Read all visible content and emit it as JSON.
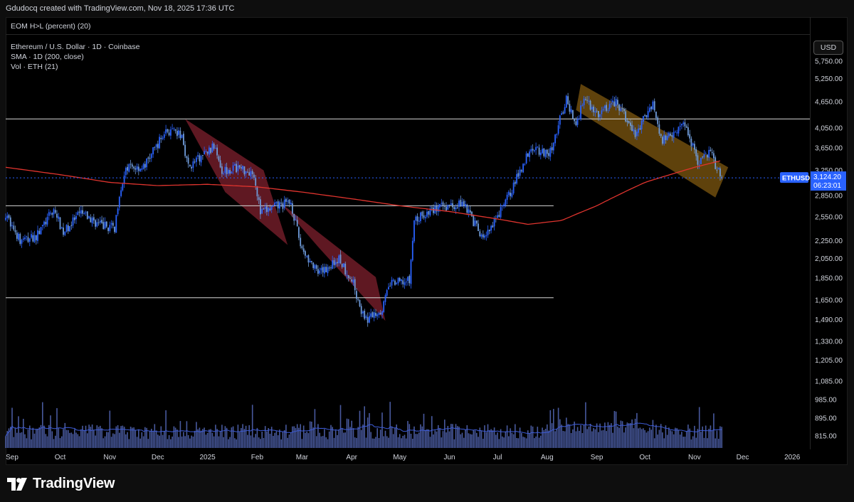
{
  "header": {
    "credit": "Gdudocq created with TradingView.com, Nov 18, 2025 17:36 UTC"
  },
  "indicator_title": "EOM H>L (percent) (20)",
  "legend": {
    "symbol": "Ethereum / U.S. Dollar · 1D · Coinbase",
    "sma": "SMA · 1D (200, close)",
    "vol": "Vol · ETH (21)"
  },
  "currency_button": "USD",
  "footer": {
    "brand": "TradingView"
  },
  "colors": {
    "up": "#2962ff",
    "down": "#6f9bd9",
    "sma": "#e0342e",
    "red_channel": "#7a1f2b",
    "orange_channel": "#7a5410",
    "hline": "#d7d7d7",
    "last_price_label": "#2962ff",
    "volume": "#5a6fc4",
    "volume_ma": "#3d5bd6"
  },
  "chart_data": {
    "type": "candlestick",
    "symbol_tag": "ETHUSD",
    "last_price": "3,124.20",
    "countdown": "06:23:01",
    "y_axis": {
      "scale": "log",
      "ticks": [
        "5,750.00",
        "5,250.00",
        "4,650.00",
        "4,050.00",
        "3,650.00",
        "3,250.00",
        "2,850.00",
        "2,550.00",
        "2,250.00",
        "2,050.00",
        "1,850.00",
        "1,650.00",
        "1,490.00",
        "1,330.00",
        "1,205.00",
        "1,085.00",
        "985.00",
        "895.00",
        "815.00"
      ],
      "tick_values": [
        5750,
        5250,
        4650,
        4050,
        3650,
        3250,
        2850,
        2550,
        2250,
        2050,
        1850,
        1650,
        1490,
        1330,
        1205,
        1085,
        985,
        895,
        815
      ]
    },
    "x_axis": {
      "ticks": [
        "Sep",
        "Oct",
        "Nov",
        "Dec",
        "2025",
        "Feb",
        "Mar",
        "Apr",
        "May",
        "Jun",
        "Jul",
        "Aug",
        "Sep",
        "Oct",
        "Nov",
        "Dec",
        "2026"
      ],
      "tick_dates": [
        "2024-09-01",
        "2024-10-01",
        "2024-11-01",
        "2024-12-01",
        "2025-01-01",
        "2025-02-01",
        "2025-03-01",
        "2025-04-01",
        "2025-05-01",
        "2025-06-01",
        "2025-07-01",
        "2025-08-01",
        "2025-09-01",
        "2025-10-01",
        "2025-11-01",
        "2025-12-01",
        "2026-01-01"
      ],
      "range": [
        "2024-08-28",
        "2026-01-12"
      ],
      "last_bar": "2025-11-18"
    },
    "price_path": [
      [
        "2024-08-28",
        2600
      ],
      [
        "2024-09-06",
        2250
      ],
      [
        "2024-09-16",
        2300
      ],
      [
        "2024-09-27",
        2650
      ],
      [
        "2024-10-03",
        2350
      ],
      [
        "2024-10-14",
        2600
      ],
      [
        "2024-10-25",
        2450
      ],
      [
        "2024-11-04",
        2400
      ],
      [
        "2024-11-07",
        2900
      ],
      [
        "2024-11-12",
        3300
      ],
      [
        "2024-11-22",
        3300
      ],
      [
        "2024-12-06",
        4000
      ],
      [
        "2024-12-16",
        3900
      ],
      [
        "2024-12-20",
        3300
      ],
      [
        "2025-01-06",
        3700
      ],
      [
        "2025-01-10",
        3250
      ],
      [
        "2025-01-20",
        3300
      ],
      [
        "2025-01-30",
        3200
      ],
      [
        "2025-02-03",
        2600
      ],
      [
        "2025-02-14",
        2700
      ],
      [
        "2025-02-22",
        2750
      ],
      [
        "2025-02-28",
        2200
      ],
      [
        "2025-03-11",
        1880
      ],
      [
        "2025-03-24",
        2050
      ],
      [
        "2025-04-02",
        1800
      ],
      [
        "2025-04-09",
        1480
      ],
      [
        "2025-04-20",
        1580
      ],
      [
        "2025-04-25",
        1800
      ],
      [
        "2025-05-07",
        1820
      ],
      [
        "2025-05-10",
        2500
      ],
      [
        "2025-05-22",
        2650
      ],
      [
        "2025-06-10",
        2750
      ],
      [
        "2025-06-22",
        2250
      ],
      [
        "2025-06-30",
        2500
      ],
      [
        "2025-07-11",
        3000
      ],
      [
        "2025-07-22",
        3700
      ],
      [
        "2025-08-02",
        3500
      ],
      [
        "2025-08-13",
        4700
      ],
      [
        "2025-08-19",
        4100
      ],
      [
        "2025-08-24",
        4800
      ],
      [
        "2025-09-01",
        4350
      ],
      [
        "2025-09-13",
        4650
      ],
      [
        "2025-09-25",
        3900
      ],
      [
        "2025-10-06",
        4650
      ],
      [
        "2025-10-11",
        3800
      ],
      [
        "2025-10-26",
        4150
      ],
      [
        "2025-11-04",
        3350
      ],
      [
        "2025-11-10",
        3600
      ],
      [
        "2025-11-18",
        3124.2
      ]
    ],
    "sma_200": [
      [
        "2024-08-28",
        3300
      ],
      [
        "2024-09-30",
        3180
      ],
      [
        "2024-11-01",
        3050
      ],
      [
        "2024-12-01",
        3000
      ],
      [
        "2025-01-01",
        3020
      ],
      [
        "2025-02-01",
        2980
      ],
      [
        "2025-03-01",
        2900
      ],
      [
        "2025-04-01",
        2800
      ],
      [
        "2025-05-01",
        2700
      ],
      [
        "2025-06-01",
        2620
      ],
      [
        "2025-07-01",
        2520
      ],
      [
        "2025-07-20",
        2450
      ],
      [
        "2025-08-10",
        2500
      ],
      [
        "2025-09-01",
        2700
      ],
      [
        "2025-10-01",
        3050
      ],
      [
        "2025-11-01",
        3300
      ],
      [
        "2025-11-18",
        3420
      ]
    ],
    "horizontal_lines": [
      {
        "value": 4250,
        "from": "2024-08-28",
        "to": "2026-01-12"
      },
      {
        "value": 2700,
        "from": "2024-08-28",
        "to": "2025-08-05"
      },
      {
        "value": 1670,
        "from": "2024-08-28",
        "to": "2025-08-05"
      }
    ],
    "channels": [
      {
        "color": "red",
        "upper": [
          [
            "2024-12-18",
            4250
          ],
          [
            "2025-02-05",
            3250
          ]
        ],
        "lower": [
          [
            "2025-01-12",
            2900
          ],
          [
            "2025-02-20",
            2200
          ]
        ]
      },
      {
        "color": "red",
        "upper": [
          [
            "2025-02-15",
            2750
          ],
          [
            "2025-04-16",
            1860
          ]
        ],
        "lower": [
          [
            "2025-03-11",
            2180
          ],
          [
            "2025-04-22",
            1480
          ]
        ]
      },
      {
        "color": "orange",
        "upper": [
          [
            "2025-08-22",
            5100
          ],
          [
            "2025-11-22",
            3300
          ]
        ],
        "lower": [
          [
            "2025-08-19",
            4450
          ],
          [
            "2025-11-14",
            2820
          ]
        ]
      }
    ],
    "volume_ma_level": "low and flat, rising slightly in Aug–Sep 2025"
  }
}
